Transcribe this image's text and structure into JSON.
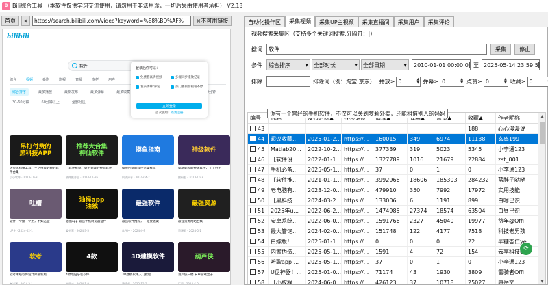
{
  "window": {
    "title": "Bili综合工具 （本软件仅供学习交流使用，请勿用于非法用途，一切后果由使用者承担） V2.13"
  },
  "left": {
    "home_label": "首页",
    "back_label": "<",
    "url": "https://search.bilibili.com/video?keyword=%E8%BD%AF%",
    "broken_link_label": "×不可用链接",
    "bili": {
      "logo": "bilibili",
      "search_text": "软件",
      "tabs": [
        "综合",
        "视频",
        "番剧",
        "影视",
        "直播",
        "专栏",
        "用户"
      ],
      "filters": [
        "综合排序",
        "最多播放",
        "最新发布",
        "最多弹幕",
        "最多收藏",
        "全部时长",
        "10分钟以下",
        "10-30分钟",
        "30-60分钟",
        "60分钟以上",
        "全部分区"
      ],
      "login": {
        "title": "登录后你可以：",
        "items": [
          "免费看高清视频",
          "多端同步播放记录",
          "发表弹幕/评论",
          "热门番剧影视看不停"
        ],
        "button": "立即登录",
        "register_prefix": "首次使用？",
        "register_link": "点我注册"
      },
      "avatar_label": "登录",
      "cards": [
        {
          "thumb": "吊打付费的\n黑科技APP",
          "bg": "#1a1a1a",
          "fg": "#ffd400",
          "title": "这些黑科技工具，生活技能必备的软件合集",
          "meta": "小小软件 · 2023-10-3"
        },
        {
          "thumb": "推荐大合集\n神仙软件",
          "bg": "#1c1c1c",
          "fg": "#7cf05a",
          "title": "【软件推荐】好用到爆的神仙软件",
          "meta": "软件推荐官 · 2024-11-26"
        },
        {
          "thumb": "摸鱼指南",
          "bg": "#1f7ae0",
          "fg": "#ffffff",
          "title": "摸鱼必备的软件合集推荐",
          "meta": "科技分享 · 2024-04-2"
        },
        {
          "thumb": "神级软件",
          "bg": "#3a2a5a",
          "fg": "#ffcc33",
          "title": "电脑必装的神级软件，个个好用",
          "meta": "数码君 · 2023-10-3"
        },
        {
          "thumb": "吐槽",
          "bg": "#6a5a72",
          "fg": "#ffffff",
          "title": "软件一个接一个用，不如这些",
          "meta": "UP主 · 2024-02-1"
        },
        {
          "thumb": "油猴app\n油猴",
          "bg": "#111111",
          "fg": "#ffd400",
          "title": "油猴app 最强手机浏览器插件",
          "meta": "爱分享 · 2024-3-5"
        },
        {
          "thumb": "最强软件",
          "bg": "#0a2a6a",
          "fg": "#ffffff",
          "title": "最强软件推荐，一定要收藏",
          "meta": "软件控 · 2024-4-9"
        },
        {
          "thumb": "最强资源",
          "bg": "#202020",
          "fg": "#ffd400",
          "title": "最强资源网站合集",
          "meta": "资源君 · 2024-5-1"
        },
        {
          "thumb": "软考",
          "bg": "#2a3a8a",
          "fg": "#ffd400",
          "title": "软考中级软件设计师最新版",
          "meta": "考试通 · 2024-3-1"
        },
        {
          "thumb": "4款",
          "bg": "#101010",
          "fg": "#ffffff",
          "title": "4款电脑必装软件",
          "meta": "实用派 · 2024-1-8"
        },
        {
          "thumb": "3D建模软件",
          "bg": "#1a1a3a",
          "fg": "#ffffff",
          "title": "3D建模软件入门教程",
          "meta": "建模师 · 2023-12-2"
        },
        {
          "thumb": "葫芦侠",
          "bg": "#2a1a2a",
          "fg": "#7cf05a",
          "title": "葫芦侠三楼 安卓游戏盒子",
          "meta": "玩家 · 2024-6-2"
        }
      ]
    }
  },
  "right": {
    "tabs": [
      "自动化操作区",
      "采集视频",
      "采集UP主视频",
      "采集直播间",
      "采集用户",
      "采集评论"
    ],
    "active_tab": 1,
    "group_label": "视频搜索采集区（支持多个关键词搜索,分隔符：|）",
    "keyword_label": "搜词",
    "keyword_value": "软件",
    "collect_button": "采集",
    "stop_button": "停止",
    "condition_label": "条件",
    "sort_select": "综合排序",
    "duration_select": "全部时长",
    "date_select": "全部日期",
    "date_from": "2010-01-01 00:00:0",
    "date_to_label": "至",
    "date_to": "2025-05-14 23:59:5",
    "exclude_label": "排除",
    "exclude_value": "",
    "exclude_hint": "排除词（例：淘宝|京东）",
    "play_label": "播放≥",
    "play_value": "0",
    "danmu_label": "弹幕≥",
    "danmu_value": "0",
    "like_label": "点赞≥",
    "like_value": "0",
    "fav_label": "收藏≥",
    "fav_value": "0",
    "columns": [
      "编号",
      "标题",
      "发布时间▲",
      "视频链接",
      "播放▲",
      "弹幕▲",
      "点赞▲",
      "收藏▲",
      "作者昵称"
    ],
    "rows": [
      [
        "43",
        "",
        "",
        "",
        "",
        "",
        "",
        "188",
        "心心漫漫说"
      ],
      [
        "44",
        "超议收藏...",
        "2025-01-2...",
        "https://...",
        "160015",
        "349",
        "6974",
        "11138",
        "玄离199"
      ],
      [
        "45",
        "Matlab20...",
        "2022-10-2...",
        "https://...",
        "377339",
        "319",
        "5023",
        "5345",
        "小宁通123"
      ],
      [
        "46",
        "【软件设...",
        "2022-01-1...",
        "https://...",
        "1327789",
        "1016",
        "21679",
        "22884",
        "zst_001"
      ],
      [
        "47",
        "手机必备...",
        "2025-05-1...",
        "https://...",
        "37",
        "0",
        "1",
        "0",
        "小李通123"
      ],
      [
        "48",
        "【软件推...",
        "2021-01-1...",
        "https://...",
        "3992966",
        "18606",
        "185303",
        "284232",
        "蓝胖子哒哒"
      ],
      [
        "49",
        "老电脑有...",
        "2023-12-0...",
        "https://...",
        "479910",
        "350",
        "7992",
        "17972",
        "实用技能"
      ],
      [
        "50",
        "【黑科技...",
        "2024-03-2...",
        "https://...",
        "133006",
        "6",
        "1191",
        "899",
        "白嗯已识"
      ],
      [
        "51",
        "2025年u...",
        "2022-06-2...",
        "https://...",
        "1474985",
        "27374",
        "18574",
        "63504",
        "白昼已识"
      ],
      [
        "52",
        "安卓系统...",
        "2022-06-0...",
        "https://...",
        "1591766",
        "2327",
        "45040",
        "19977",
        "益年@Offi"
      ],
      [
        "53",
        "最大管饱...",
        "2024-02-0...",
        "https://...",
        "151748",
        "122",
        "4177",
        "7518",
        "科技老男孩"
      ],
      [
        "54",
        "白嫖版！...",
        "2025-01-1...",
        "https://...",
        "0",
        "0",
        "0",
        "22",
        "半糖杏仁ye"
      ],
      [
        "55",
        "内置伪造...",
        "2025-05-1...",
        "https://...",
        "1591",
        "4",
        "72",
        "154",
        "云享科技G"
      ],
      [
        "56",
        "听歌app ...",
        "2025-05-1...",
        "https://...",
        "37",
        "0",
        "1",
        "0",
        "小李通123"
      ],
      [
        "57",
        "U盘神器！...",
        "2025-01-0...",
        "https://...",
        "71174",
        "43",
        "1930",
        "3809",
        "雷骑者Offi"
      ],
      [
        "58",
        "【小权程...",
        "2024-06-0...",
        "https://...",
        "426123",
        "37",
        "10718",
        "25027",
        "康岳文"
      ],
      [
        "59",
        "【用Deep...",
        "2025-02-1...",
        "https://...",
        "50844",
        "107",
        "1749",
        "2453",
        "小迪xiaodi..."
      ]
    ],
    "selected_row": 1,
    "tooltip": "你有一个曾经的手机软件，不仅可以关到萝莉外卖，还能租借别人的妈妈"
  },
  "colors": {
    "bili_blue": "#00aeec",
    "selection": "#0078d7",
    "pink": "#fb7299"
  }
}
